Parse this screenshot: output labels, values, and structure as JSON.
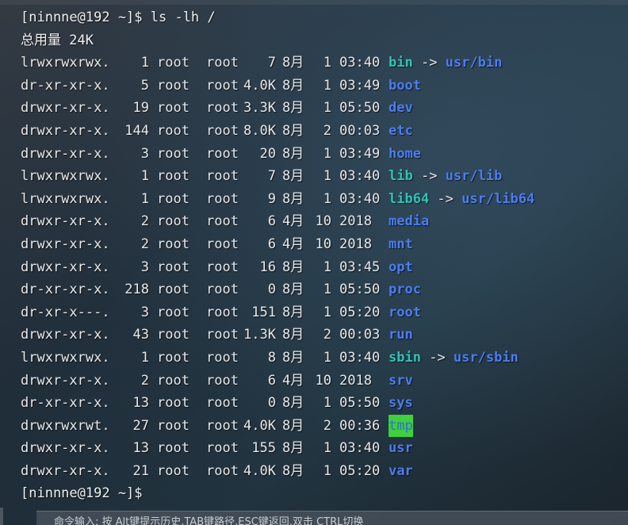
{
  "colors": {
    "link": "#2ec4b6",
    "directory": "#4c7df0",
    "sticky_bg": "#3fcf3f",
    "sticky_fg": "#2e6fd8",
    "text": "#e8e8e8"
  },
  "terminal": {
    "prompt1": "[ninnne@192 ~]$ ls -lh /",
    "total": "总用量 24K",
    "prompt2": "[ninnne@192 ~]$",
    "entries": [
      {
        "perms": "lrwxrwxrwx.",
        "links": "1",
        "owner": "root",
        "group": "root",
        "size": "7",
        "month": "8月",
        "day": "1",
        "time": "03:40",
        "name": "bin",
        "type": "link",
        "target": "usr/bin"
      },
      {
        "perms": "dr-xr-xr-x.",
        "links": "5",
        "owner": "root",
        "group": "root",
        "size": "4.0K",
        "month": "8月",
        "day": "1",
        "time": "03:49",
        "name": "boot",
        "type": "dir",
        "target": ""
      },
      {
        "perms": "drwxr-xr-x.",
        "links": "19",
        "owner": "root",
        "group": "root",
        "size": "3.3K",
        "month": "8月",
        "day": "1",
        "time": "05:50",
        "name": "dev",
        "type": "dir",
        "target": ""
      },
      {
        "perms": "drwxr-xr-x.",
        "links": "144",
        "owner": "root",
        "group": "root",
        "size": "8.0K",
        "month": "8月",
        "day": "2",
        "time": "00:03",
        "name": "etc",
        "type": "dir",
        "target": ""
      },
      {
        "perms": "drwxr-xr-x.",
        "links": "3",
        "owner": "root",
        "group": "root",
        "size": "20",
        "month": "8月",
        "day": "1",
        "time": "03:49",
        "name": "home",
        "type": "dir",
        "target": ""
      },
      {
        "perms": "lrwxrwxrwx.",
        "links": "1",
        "owner": "root",
        "group": "root",
        "size": "7",
        "month": "8月",
        "day": "1",
        "time": "03:40",
        "name": "lib",
        "type": "link",
        "target": "usr/lib"
      },
      {
        "perms": "lrwxrwxrwx.",
        "links": "1",
        "owner": "root",
        "group": "root",
        "size": "9",
        "month": "8月",
        "day": "1",
        "time": "03:40",
        "name": "lib64",
        "type": "link",
        "target": "usr/lib64"
      },
      {
        "perms": "drwxr-xr-x.",
        "links": "2",
        "owner": "root",
        "group": "root",
        "size": "6",
        "month": "4月",
        "day": "10",
        "time": "2018",
        "name": "media",
        "type": "dir",
        "target": ""
      },
      {
        "perms": "drwxr-xr-x.",
        "links": "2",
        "owner": "root",
        "group": "root",
        "size": "6",
        "month": "4月",
        "day": "10",
        "time": "2018",
        "name": "mnt",
        "type": "dir",
        "target": ""
      },
      {
        "perms": "drwxr-xr-x.",
        "links": "3",
        "owner": "root",
        "group": "root",
        "size": "16",
        "month": "8月",
        "day": "1",
        "time": "03:45",
        "name": "opt",
        "type": "dir",
        "target": ""
      },
      {
        "perms": "dr-xr-xr-x.",
        "links": "218",
        "owner": "root",
        "group": "root",
        "size": "0",
        "month": "8月",
        "day": "1",
        "time": "05:50",
        "name": "proc",
        "type": "dir",
        "target": ""
      },
      {
        "perms": "dr-xr-x---.",
        "links": "3",
        "owner": "root",
        "group": "root",
        "size": "151",
        "month": "8月",
        "day": "1",
        "time": "05:20",
        "name": "root",
        "type": "dir",
        "target": ""
      },
      {
        "perms": "drwxr-xr-x.",
        "links": "43",
        "owner": "root",
        "group": "root",
        "size": "1.3K",
        "month": "8月",
        "day": "2",
        "time": "00:03",
        "name": "run",
        "type": "dir",
        "target": ""
      },
      {
        "perms": "lrwxrwxrwx.",
        "links": "1",
        "owner": "root",
        "group": "root",
        "size": "8",
        "month": "8月",
        "day": "1",
        "time": "03:40",
        "name": "sbin",
        "type": "link",
        "target": "usr/sbin"
      },
      {
        "perms": "drwxr-xr-x.",
        "links": "2",
        "owner": "root",
        "group": "root",
        "size": "6",
        "month": "4月",
        "day": "10",
        "time": "2018",
        "name": "srv",
        "type": "dir",
        "target": ""
      },
      {
        "perms": "dr-xr-xr-x.",
        "links": "13",
        "owner": "root",
        "group": "root",
        "size": "0",
        "month": "8月",
        "day": "1",
        "time": "05:50",
        "name": "sys",
        "type": "dir",
        "target": ""
      },
      {
        "perms": "drwxrwxrwt.",
        "links": "27",
        "owner": "root",
        "group": "root",
        "size": "4.0K",
        "month": "8月",
        "day": "2",
        "time": "00:36",
        "name": "tmp",
        "type": "sticky",
        "target": ""
      },
      {
        "perms": "drwxr-xr-x.",
        "links": "13",
        "owner": "root",
        "group": "root",
        "size": "155",
        "month": "8月",
        "day": "1",
        "time": "03:40",
        "name": "usr",
        "type": "dir",
        "target": ""
      },
      {
        "perms": "drwxr-xr-x.",
        "links": "21",
        "owner": "root",
        "group": "root",
        "size": "4.0K",
        "month": "8月",
        "day": "1",
        "time": "05:20",
        "name": "var",
        "type": "dir",
        "target": ""
      }
    ]
  },
  "status_bar": {
    "text": "命令输入: 按 Alt键提示历史,TAB键路径,ESC键返回,双击 CTRL切换"
  }
}
